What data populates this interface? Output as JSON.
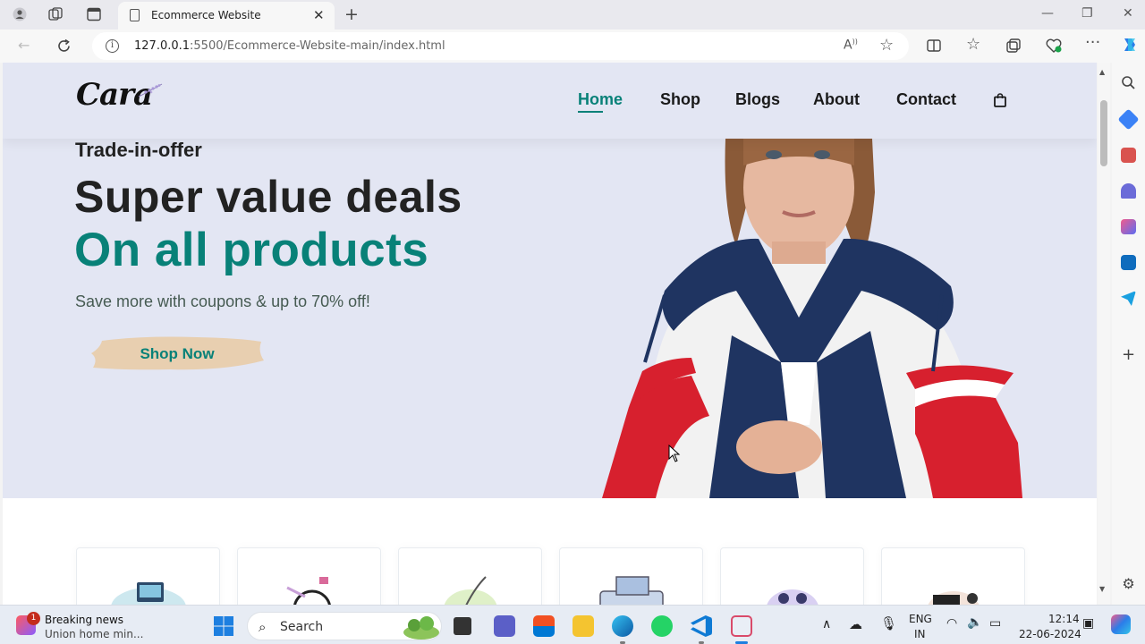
{
  "browser": {
    "tab_title": "Ecommerce Website",
    "url_host": "127.0.0.1",
    "url_path": ":5500/Ecommerce-Website-main/index.html"
  },
  "site": {
    "logo": "Cara",
    "nav": [
      "Home",
      "Shop",
      "Blogs",
      "About",
      "Contact"
    ],
    "active_nav": "Home",
    "accent_color": "#088178",
    "hero_bg": "#e3e6f3"
  },
  "hero": {
    "kicker": "Trade-in-offer",
    "title": "Super value deals",
    "subtitle": "On all products",
    "text": "Save more with coupons & up to 70% off!",
    "button": "Shop Now"
  },
  "taskbar": {
    "news_title": "Breaking news",
    "news_sub": "Union home min...",
    "news_badge": "1",
    "search_label": "Search",
    "lang_1": "ENG",
    "lang_2": "IN",
    "time": "12:14",
    "date": "22-06-2024"
  }
}
